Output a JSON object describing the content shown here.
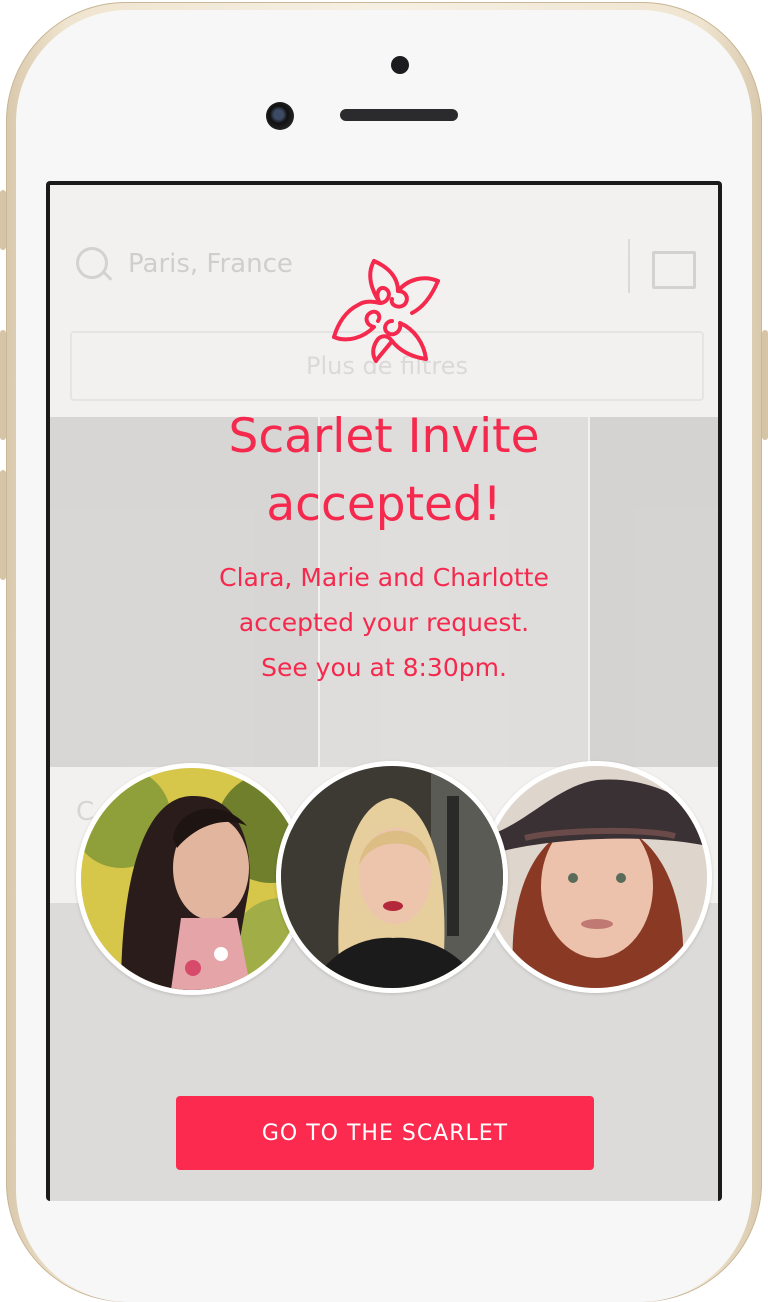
{
  "background_app": {
    "search_text": "Paris, France",
    "filter_button_label": "Plus de filtres",
    "row_label": "C"
  },
  "modal": {
    "title_line1": "Scarlet Invite",
    "title_line2": "accepted!",
    "message_line1": "Clara, Marie and Charlotte",
    "message_line2": "accepted your request.",
    "message_line3": "See you at 8:30pm.",
    "avatars": [
      {
        "icon": "avatar-clara"
      },
      {
        "icon": "avatar-marie"
      },
      {
        "icon": "avatar-charlotte"
      }
    ],
    "cta_label": "GO TO THE SCARLET"
  },
  "colors": {
    "accent": "#fc2a4f",
    "text_accent": "#f5294d",
    "phone_frame": "#efe4cf",
    "screen_bg": "#f3f1ef"
  }
}
